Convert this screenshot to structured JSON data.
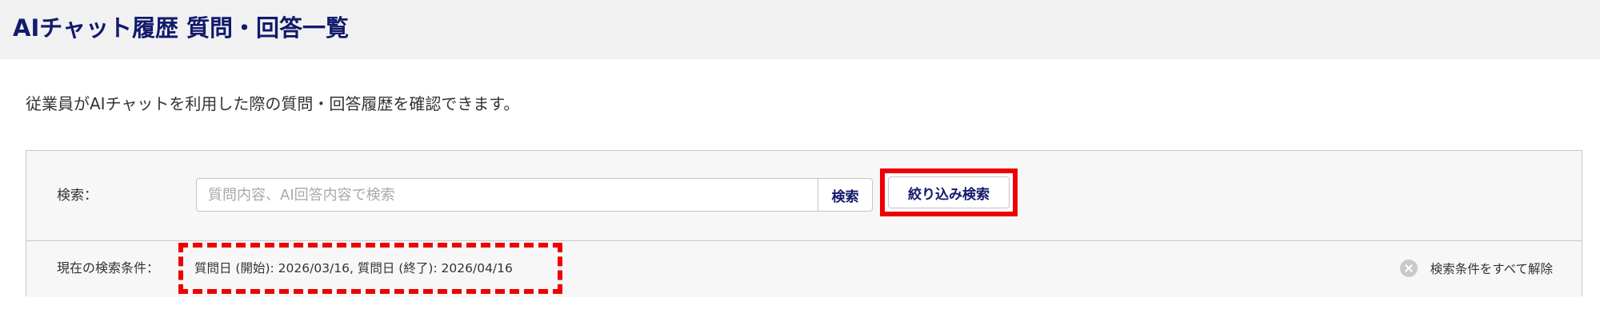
{
  "header": {
    "title": "AIチャット履歴 質問・回答一覧"
  },
  "description": "従業員がAIチャットを利用した際の質問・回答履歴を確認できます。",
  "search": {
    "label": "検索：",
    "placeholder": "質問内容、AI回答内容で検索",
    "value": "",
    "search_button_label": "検索",
    "filter_button_label": "絞り込み検索"
  },
  "conditions": {
    "label": "現在の検索条件：",
    "value": "質問日 (開始): 2026/03/16, 質問日 (終了): 2026/04/16",
    "clear_all_label": "検索条件をすべて解除",
    "clear_icon": "close-circle-icon"
  },
  "colors": {
    "brand_navy": "#121a6b",
    "highlight_red": "#ee0000",
    "header_bg": "#f1f1f1",
    "panel_bg": "#f7f7f7"
  }
}
